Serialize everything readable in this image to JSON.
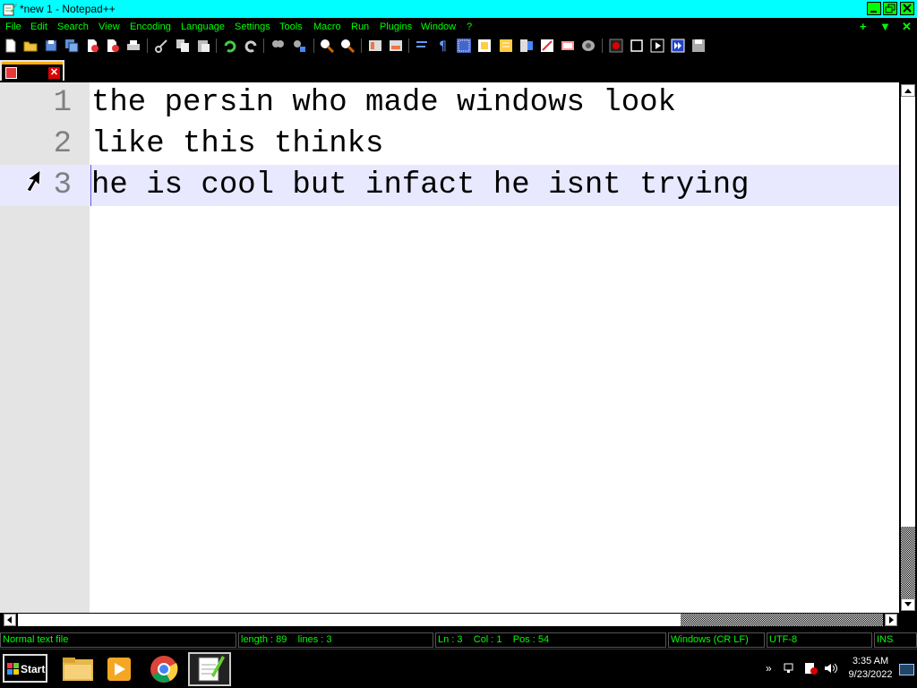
{
  "window": {
    "title": "*new 1 - Notepad++"
  },
  "menu": {
    "items": [
      "File",
      "Edit",
      "Search",
      "View",
      "Encoding",
      "Language",
      "Settings",
      "Tools",
      "Macro",
      "Run",
      "Plugins",
      "Window",
      "?"
    ],
    "controls": [
      "+",
      "▼",
      "✕"
    ]
  },
  "toolbar": {
    "icons": [
      "new-file-icon",
      "open-file-icon",
      "save-icon",
      "save-all-icon",
      "close-icon",
      "close-all-icon",
      "print-icon",
      "cut-icon",
      "copy-icon",
      "paste-icon",
      "undo-icon",
      "redo-icon",
      "find-icon",
      "replace-icon",
      "zoom-in-icon",
      "zoom-out-icon",
      "sync-vertical-icon",
      "sync-horizontal-icon",
      "word-wrap-icon",
      "show-all-chars-icon",
      "indent-guide-icon",
      "language-icon",
      "function-list-icon",
      "folder-as-workspace-icon",
      "doc-map-icon",
      "doc-list-icon",
      "monitoring-icon",
      "record-macro-icon",
      "stop-macro-icon",
      "play-macro-icon",
      "run-macro-multiple-icon",
      "save-macro-icon"
    ]
  },
  "tab": {
    "close_glyph": "✕"
  },
  "editor": {
    "lines": [
      {
        "number": "1",
        "text": "the persin who made windows look"
      },
      {
        "number": "2",
        "text": "like this thinks"
      },
      {
        "number": "3",
        "text": "he is cool but infact he isnt trying"
      }
    ],
    "current_line": 3
  },
  "status": {
    "file_type": "Normal text file",
    "length_lines": "length : 89    lines : 3",
    "position": "Ln : 3    Col : 1    Pos : 54",
    "eol": "Windows (CR LF)",
    "encoding": "UTF-8",
    "mode": "INS"
  },
  "taskbar": {
    "start_label": "Start",
    "apps": [
      "file-explorer",
      "media-player",
      "chrome",
      "notepad-plus-plus"
    ],
    "active_app": "notepad-plus-plus",
    "tray_chevron": "»",
    "time": "3:35 AM",
    "date": "9/23/2022"
  },
  "colors": {
    "titlebar": "#00ffff",
    "menu_text": "#00ff00",
    "current_line": "#e8e8ff",
    "gutter": "#e4e4e4",
    "tab_accent": "#ffb000"
  }
}
